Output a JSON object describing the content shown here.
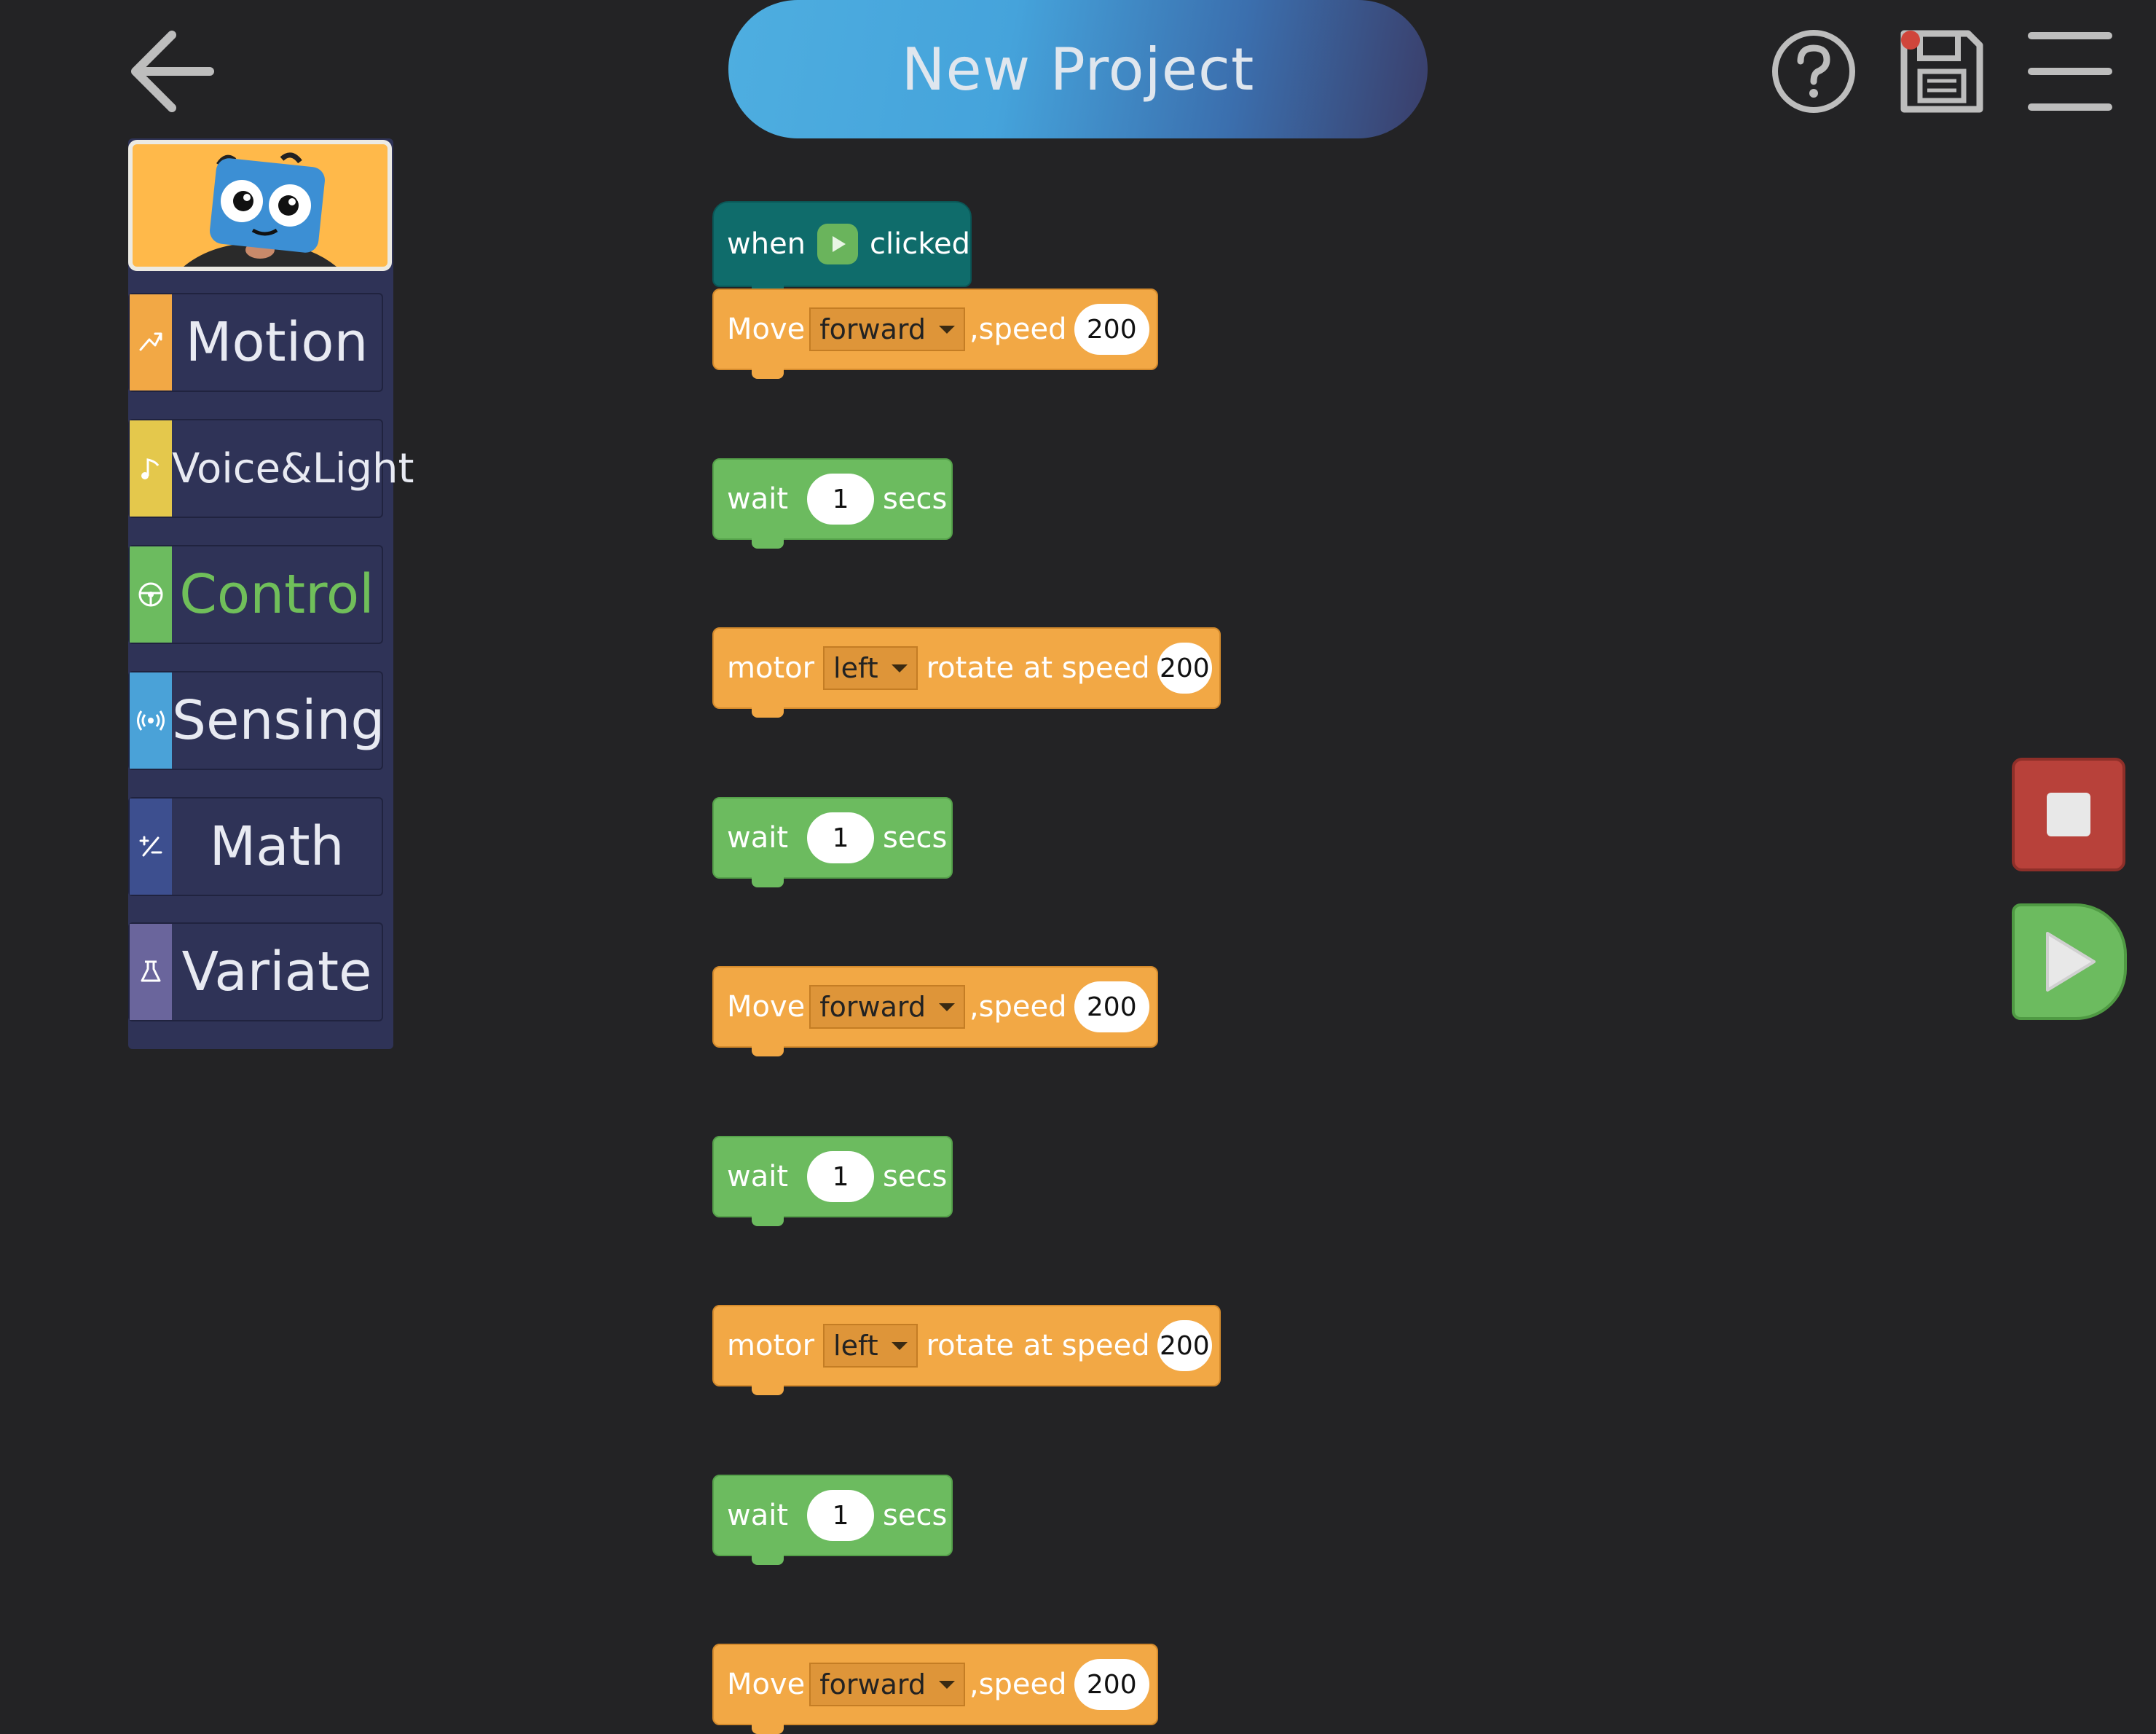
{
  "header": {
    "title": "New Project"
  },
  "sidebar": {
    "categories": [
      {
        "label": "Motion",
        "color": "#f2a845",
        "icon": "motion-icon"
      },
      {
        "label": "Voice&Light",
        "color": "#e4c84c",
        "icon": "music-note-icon"
      },
      {
        "label": "Control",
        "color": "#6cbb5f",
        "icon": "steering-wheel-icon",
        "active": true
      },
      {
        "label": "Sensing",
        "color": "#4aa2d8",
        "icon": "signal-icon"
      },
      {
        "label": "Math",
        "color": "#3d4f8f",
        "icon": "math-icon"
      },
      {
        "label": "Variate",
        "color": "#6a659c",
        "icon": "flask-icon"
      }
    ]
  },
  "script": {
    "hat": {
      "when": "when",
      "clicked": "clicked"
    },
    "blocks": [
      {
        "type": "move",
        "label": "Move",
        "direction": "forward",
        "speed_label": ",speed",
        "speed": "200"
      },
      {
        "type": "wait",
        "label": "wait",
        "value": "1",
        "unit": "secs"
      },
      {
        "type": "motor",
        "label": "motor",
        "side": "left",
        "text": "rotate at speed",
        "speed": "200"
      },
      {
        "type": "wait",
        "label": "wait",
        "value": "1",
        "unit": "secs"
      },
      {
        "type": "move",
        "label": "Move",
        "direction": "forward",
        "speed_label": ",speed",
        "speed": "200"
      },
      {
        "type": "wait",
        "label": "wait",
        "value": "1",
        "unit": "secs"
      },
      {
        "type": "motor",
        "label": "motor",
        "side": "left",
        "text": "rotate at speed",
        "speed": "200"
      },
      {
        "type": "wait",
        "label": "wait",
        "value": "1",
        "unit": "secs"
      },
      {
        "type": "move",
        "label": "Move",
        "direction": "forward",
        "speed_label": ",speed",
        "speed": "200"
      }
    ]
  },
  "colors": {
    "background": "#232325",
    "motion_block": "#f2a845",
    "control_block": "#6cbb5f",
    "event_block": "#0f6c6b",
    "stop_button": "#b8413a",
    "play_button": "#6cbb5f"
  }
}
